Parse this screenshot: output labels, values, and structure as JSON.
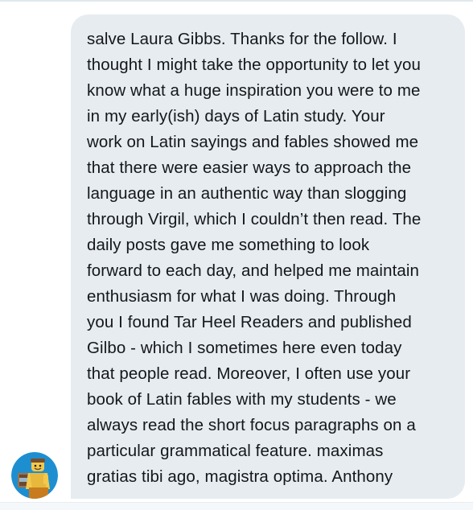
{
  "message": {
    "lines": [
      "salve Laura Gibbs. Thanks for the follow. I",
      "thought I might take the opportunity to let you",
      "know what a huge inspiration you were to me",
      "in my early(ish) days of Latin study. Your",
      "work on Latin sayings and fables showed me",
      "that there were easier ways to approach the",
      "language in an authentic way than slogging",
      "through Virgil, which I couldn’t then read. The",
      "daily posts gave me something to look",
      "forward to each day, and helped me maintain",
      "enthusiasm for what I was doing. Through",
      "you I found Tar Heel Readers and published",
      "Gilbo - which I sometimes here even today",
      "that people read. Moreover, I often use your",
      "book of Latin fables with my students - we",
      "always read the short focus paragraphs on a",
      "particular grammatical feature. maximas",
      "gratias tibi ago, magistra optima. Anthony"
    ]
  },
  "sender": {
    "avatar_icon": "lego-figure-avatar-icon"
  },
  "colors": {
    "bubble_bg": "#e6ecf0",
    "text": "#14171a",
    "avatar_bg": "#1d8fd1"
  }
}
